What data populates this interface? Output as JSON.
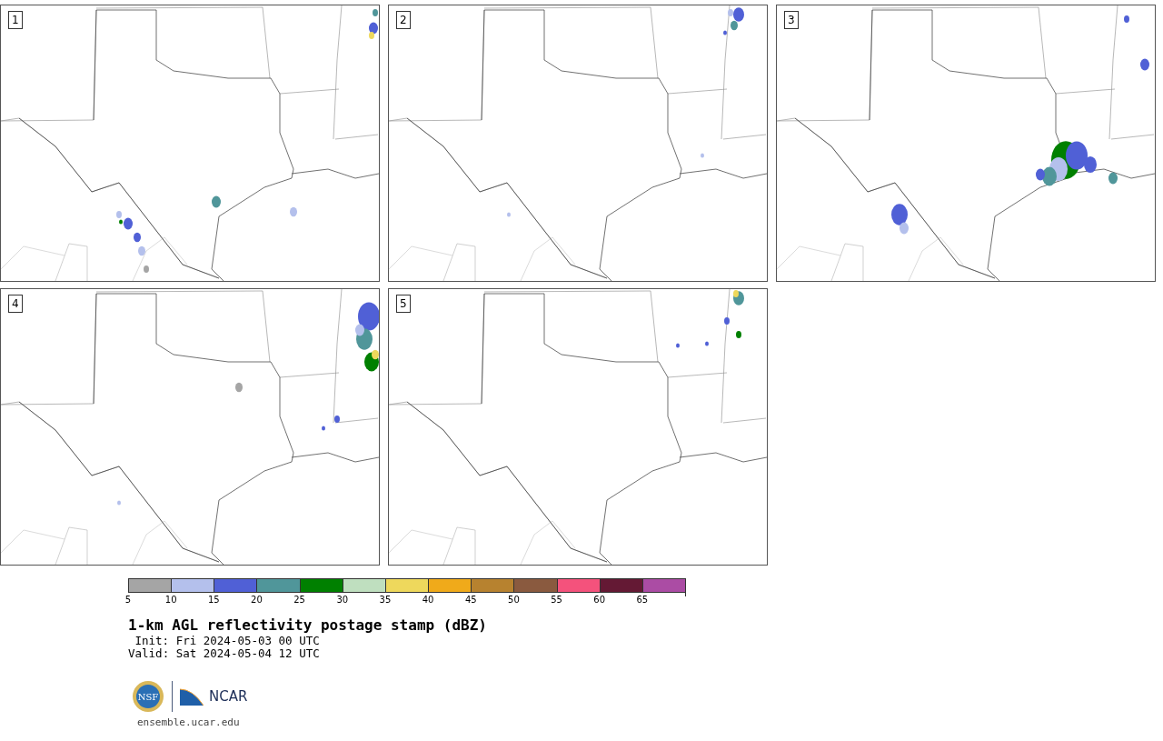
{
  "panels": [
    {
      "label": "1"
    },
    {
      "label": "2"
    },
    {
      "label": "3"
    },
    {
      "label": "4"
    },
    {
      "label": "5"
    }
  ],
  "colorbar": {
    "segments": [
      {
        "color": "#a5a5a5",
        "tick": "5"
      },
      {
        "color": "#b4c0ec",
        "tick": "10"
      },
      {
        "color": "#5060d6",
        "tick": "15"
      },
      {
        "color": "#50969a",
        "tick": "20"
      },
      {
        "color": "#008000",
        "tick": "25"
      },
      {
        "color": "#bfdfbf",
        "tick": "30"
      },
      {
        "color": "#eed85c",
        "tick": "35"
      },
      {
        "color": "#f0aa1a",
        "tick": "40"
      },
      {
        "color": "#b7822f",
        "tick": "45"
      },
      {
        "color": "#8a5a3f",
        "tick": "50"
      },
      {
        "color": "#f4527c",
        "tick": "55"
      },
      {
        "color": "#641934",
        "tick": "60"
      },
      {
        "color": "#ab4ca4",
        "tick": "65"
      }
    ]
  },
  "title": "1-km AGL reflectivity postage stamp (dBZ)",
  "init": "Init: Fri 2024-05-03 00 UTC",
  "valid": "Valid: Sat 2024-05-04 12 UTC",
  "logos": {
    "nsf": "NSF",
    "ncar": "NCAR"
  },
  "url": "ensemble.ucar.edu"
}
